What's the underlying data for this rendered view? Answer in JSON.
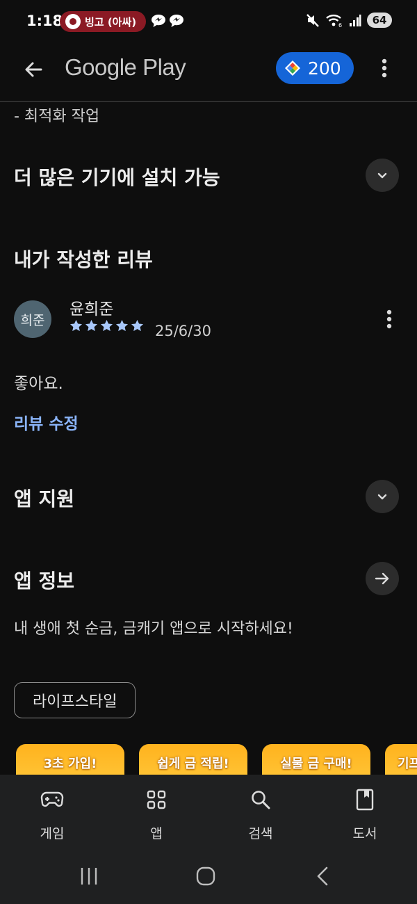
{
  "status_bar": {
    "time": "1:18",
    "notification": "빙고 (아싸)",
    "battery": "64"
  },
  "app_bar": {
    "brand": "Google Play",
    "points": "200"
  },
  "content": {
    "prev_item": "- 최적화 작업",
    "more_devices_title": "더 많은 기기에 설치 가능",
    "my_review_title": "내가 작성한 리뷰",
    "review": {
      "avatar_text": "희준",
      "reviewer": "윤희준",
      "rating": 5,
      "date": "25/6/30",
      "body": "좋아요.",
      "edit_label": "리뷰 수정"
    },
    "app_support_title": "앱 지원",
    "app_info_title": "앱 정보",
    "app_info_desc": "내 생애 첫 순금, 금캐기 앱으로 시작하세요!",
    "category_chip": "라이프스타일",
    "banners": [
      "3초 가입!",
      "쉽게 금 적립!",
      "실물 금 구매!",
      "기프"
    ]
  },
  "bottom_nav": {
    "items": [
      {
        "label": "게임",
        "icon": "gamepad-icon"
      },
      {
        "label": "앱",
        "icon": "apps-grid-icon"
      },
      {
        "label": "검색",
        "icon": "search-icon"
      },
      {
        "label": "도서",
        "icon": "book-icon"
      }
    ]
  },
  "colors": {
    "background": "#0e0e0e",
    "accent_blue": "#8ab4f8",
    "points_pill": "#1565d8",
    "notification_pill": "#8b1a24",
    "star": "#a8c7fa",
    "banner": "#ffb21e"
  }
}
